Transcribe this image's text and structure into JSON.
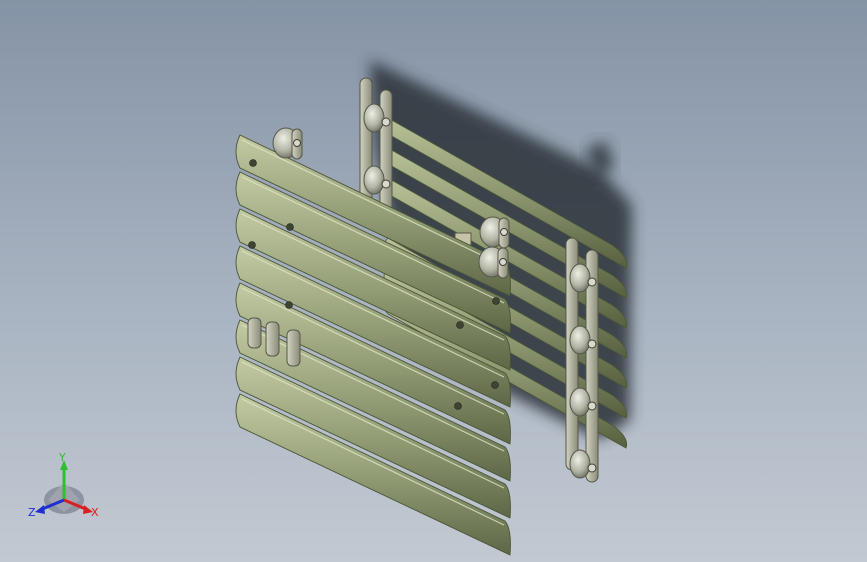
{
  "viewport": {
    "background_top": "#8593a6",
    "background_bottom": "#c2c9d2"
  },
  "model": {
    "part_color": "#8f9a72",
    "part_dark": "#5f6a48",
    "part_light": "#c0c9a0",
    "roller_color": "#b4b6a8",
    "link_color": "#a9ab96"
  },
  "triad": {
    "y_label": "Y",
    "x_label": "X",
    "z_label": "Z",
    "y_color": "#2fbf2f",
    "x_color": "#d82020",
    "z_color": "#2030d0"
  }
}
